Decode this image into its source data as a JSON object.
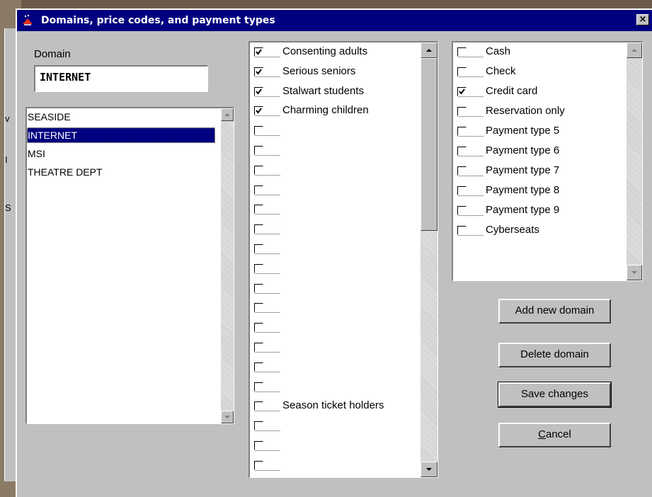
{
  "window": {
    "title": "Domains, price codes, and payment types",
    "close_label": "×"
  },
  "background": {
    "edge_chars": [
      "v",
      "I",
      "S"
    ]
  },
  "domain": {
    "label": "Domain",
    "value": "INTERNET",
    "list": [
      "SEASIDE",
      "INTERNET",
      "MSI",
      "THEATRE DEPT"
    ],
    "selected_index": 1
  },
  "price_codes": [
    {
      "label": "Consenting adults",
      "checked": true
    },
    {
      "label": "Serious seniors",
      "checked": true
    },
    {
      "label": "Stalwart students",
      "checked": true
    },
    {
      "label": "Charming children",
      "checked": true
    },
    {
      "label": "",
      "checked": false
    },
    {
      "label": "",
      "checked": false
    },
    {
      "label": "",
      "checked": false
    },
    {
      "label": "",
      "checked": false
    },
    {
      "label": "",
      "checked": false
    },
    {
      "label": "",
      "checked": false
    },
    {
      "label": "",
      "checked": false
    },
    {
      "label": "",
      "checked": false
    },
    {
      "label": "",
      "checked": false
    },
    {
      "label": "",
      "checked": false
    },
    {
      "label": "",
      "checked": false
    },
    {
      "label": "",
      "checked": false
    },
    {
      "label": "",
      "checked": false
    },
    {
      "label": "",
      "checked": false
    },
    {
      "label": "Season ticket holders",
      "checked": false
    },
    {
      "label": "",
      "checked": false
    },
    {
      "label": "",
      "checked": false
    },
    {
      "label": "",
      "checked": false
    }
  ],
  "payment_types": [
    {
      "label": "Cash",
      "checked": false
    },
    {
      "label": "Check",
      "checked": false
    },
    {
      "label": "Credit card",
      "checked": true
    },
    {
      "label": "Reservation only",
      "checked": false
    },
    {
      "label": "Payment type  5",
      "checked": false
    },
    {
      "label": "Payment type  6",
      "checked": false
    },
    {
      "label": "Payment type  7",
      "checked": false
    },
    {
      "label": "Payment type  8",
      "checked": false
    },
    {
      "label": "Payment type  9",
      "checked": false
    },
    {
      "label": "Cyberseats",
      "checked": false
    }
  ],
  "buttons": {
    "add": "Add new domain",
    "delete": "Delete domain",
    "save": "Save changes",
    "cancel_underline": "C",
    "cancel_rest": "ancel"
  },
  "colors": {
    "titlebar": "#000080",
    "dialog": "#c0c0c0",
    "selection": "#000080"
  }
}
